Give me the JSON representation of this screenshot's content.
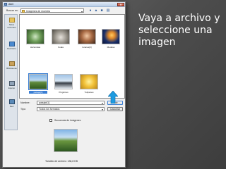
{
  "dialog": {
    "title": "Abrir",
    "close_label": "✕",
    "look_in_label": "Buscar en:",
    "look_in_value": "Imágenes de muestra"
  },
  "places": [
    {
      "label": "Sitios recientes"
    },
    {
      "label": "Escritorio"
    },
    {
      "label": "Bibliotecas"
    },
    {
      "label": "Equipo"
    },
    {
      "label": "Red"
    }
  ],
  "files": [
    {
      "name": "Hortensias",
      "icon": "flower-image"
    },
    {
      "name": "Koala",
      "icon": "koala-image"
    },
    {
      "name": "lunares[2]",
      "icon": "portrait-image"
    },
    {
      "name": "Medusa",
      "icon": "jellyfish-image"
    },
    {
      "name": "paisaje[1]",
      "icon": "landscape-image",
      "selected": true
    },
    {
      "name": "Pingüinos",
      "icon": "penguins-image"
    },
    {
      "name": "Tulipanes",
      "icon": "tulips-image"
    }
  ],
  "filename": {
    "label": "Nombre:",
    "value": "paisaje[1]"
  },
  "filetype": {
    "label": "Tipo:",
    "value": "Todos los formatos"
  },
  "buttons": {
    "open": "Abrir",
    "cancel": "Cancelar"
  },
  "sequence_checkbox": {
    "label": "Secuencia de imágenes",
    "checked": false
  },
  "file_size": "Tamaño de archivo: 136,8 KB",
  "caption": "Vaya a archivo y\nseleccione una\nimagen",
  "colors": {
    "selection": "#3b7fd4",
    "hint_arrow": "#1e9be0",
    "background": "#555555"
  }
}
